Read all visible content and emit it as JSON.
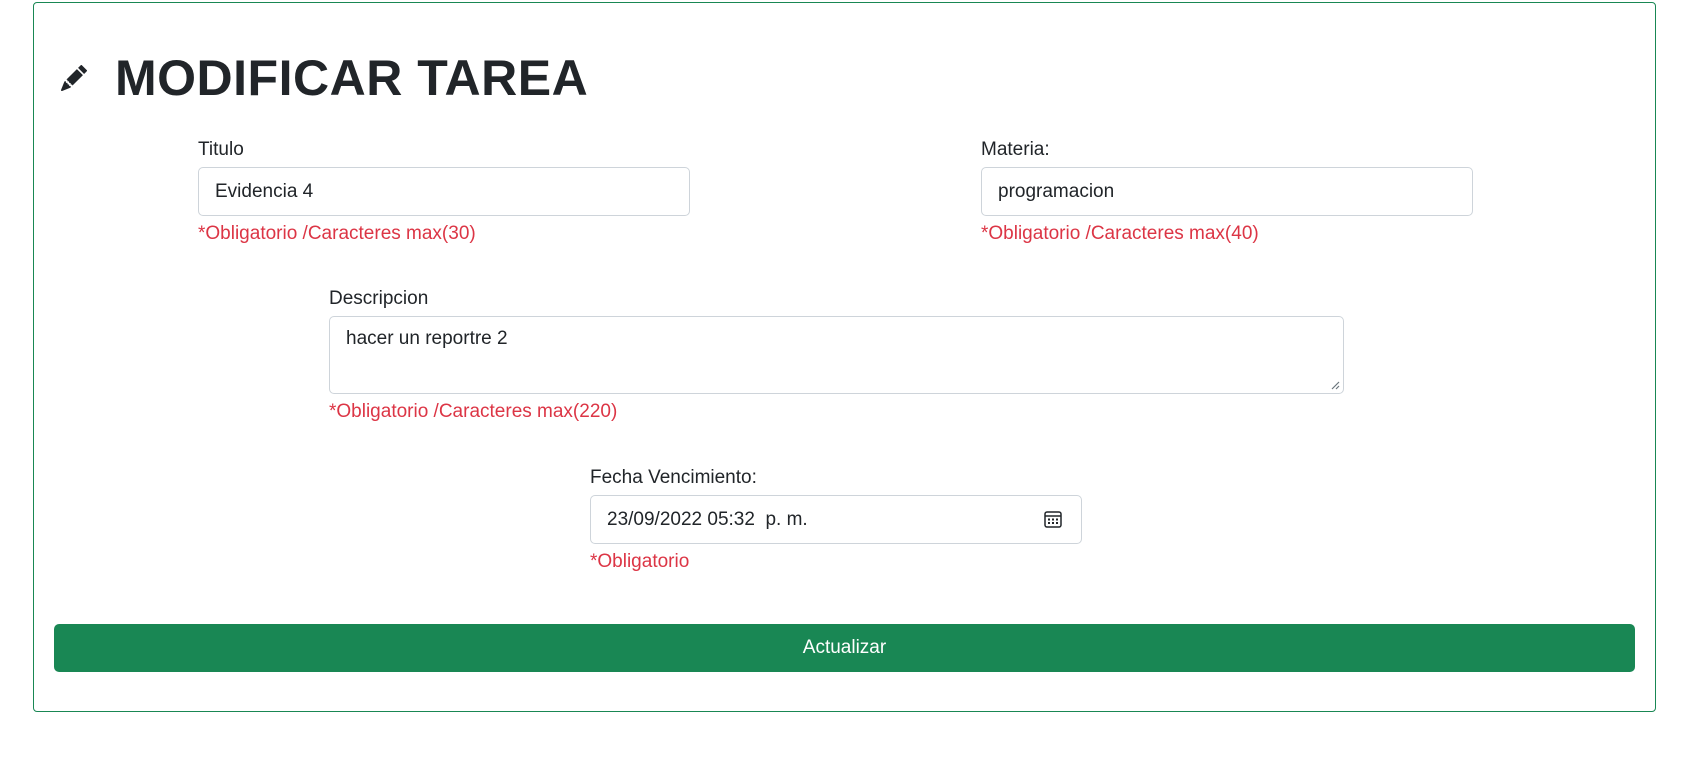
{
  "page": {
    "title": "MODIFICAR TAREA"
  },
  "form": {
    "titulo": {
      "label": "Titulo",
      "value": "Evidencia 4",
      "hint": "*Obligatorio /Caracteres max(30)"
    },
    "materia": {
      "label": "Materia:",
      "value": "programacion",
      "hint": "*Obligatorio /Caracteres max(40)"
    },
    "descripcion": {
      "label": "Descripcion",
      "value": "hacer un reportre 2",
      "hint": "*Obligatorio /Caracteres max(220)"
    },
    "fecha": {
      "label": "Fecha Vencimiento:",
      "value": "23/09/2022 05:32  p. m.",
      "hint": "*Obligatorio"
    },
    "submit_label": "Actualizar"
  },
  "colors": {
    "accent": "#198754",
    "error": "#dc3545",
    "text": "#212529",
    "border": "#ced4da"
  },
  "icons": {
    "title": "pencil-icon",
    "date": "calendar-icon"
  }
}
